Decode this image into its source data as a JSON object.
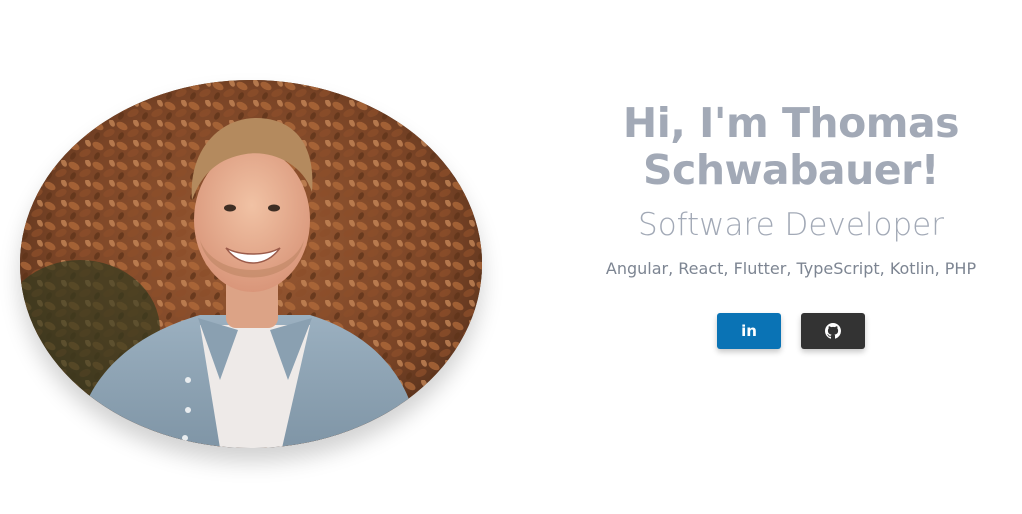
{
  "profile": {
    "name": "Hi, I'm Thomas Schwabauer!",
    "role": "Software Developer",
    "stack": "Angular, React, Flutter, TypeScript, Kotlin, PHP"
  },
  "social": {
    "linkedin": {
      "label": "in",
      "icon": "linkedin-icon",
      "color": "#0a73b5"
    },
    "github": {
      "icon": "github-icon",
      "color": "#333333"
    }
  },
  "colors": {
    "heading": "#a2a9b6",
    "subtext": "#7d8592"
  }
}
